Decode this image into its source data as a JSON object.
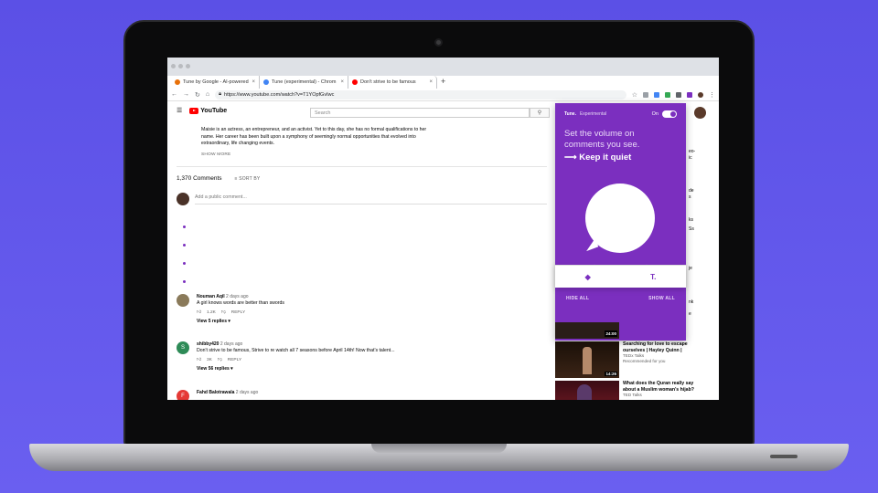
{
  "browser": {
    "tabs": [
      {
        "label": "Tune by Google - AI-powered",
        "color": "#e8710a"
      },
      {
        "label": "Tune (experimental) - Chrom",
        "color": "#4285f4"
      },
      {
        "label": "Don't strive to be famous",
        "color": "#ff0000"
      }
    ],
    "new_tab_icon": "+",
    "url": "https://www.youtube.com/watch?v=T1YOpfGvIwc"
  },
  "youtube": {
    "logo": "YouTube",
    "search_placeholder": "Search",
    "description": "Maisie is an actress, an entrepreneur, and an activist. Yet to this day, she has no formal qualifications to her name. Her career has been built upon a symphony of seemingly normal opportunities that evolved into extraordinary, life changing events.",
    "show_more": "SHOW MORE",
    "comments_count": "1,370 Comments",
    "sort_by": "SORT BY",
    "add_comment_placeholder": "Add a public comment...",
    "comments": [
      {
        "author": "Nouman Aqil",
        "time": "2 days ago",
        "text": "A girl knows words are better than swords",
        "likes": "1.2K",
        "reply": "REPLY",
        "replies": "View 5 replies",
        "avatar_color": "#8a7a5a"
      },
      {
        "author": "shibby420",
        "time": "2 days ago",
        "text": "Don't strive to be famous, Strive to re watch all 7 seasons before April 14th! Now that's talent...",
        "likes": "3K",
        "reply": "REPLY",
        "replies": "View 56 replies",
        "avatar_color": "#2e8b57",
        "initial": "S"
      },
      {
        "author": "Fahd Balotrawala",
        "time": "2 days ago",
        "text": "",
        "avatar_color": "#e53935",
        "initial": "F"
      }
    ],
    "sidebar_fragments": [
      "eo-",
      "ic",
      "de",
      "s",
      "ks",
      "Ss",
      "je",
      "nk",
      "e",
      "er",
      "s",
      "lei"
    ],
    "videos": [
      {
        "title": "Searching for love to escape ourselves | Hayley Quinn |",
        "channel": "TEDx Talks",
        "meta": "Recommended for you",
        "duration": "14:26"
      },
      {
        "title": "What does the Quran really say about a Muslim woman's hijab?",
        "channel": "TED Talks",
        "meta": ""
      }
    ],
    "prev_duration": "24:00"
  },
  "tune": {
    "brand": "Tune.",
    "experimental": "Experimental",
    "on_label": "On",
    "headline": "Set the volume on comments you see.",
    "subline": "⟶ Keep it quiet",
    "hide_all": "HIDE ALL",
    "show_all": "SHOW ALL",
    "footer_right": "T.",
    "accent": "#7b2fbf"
  }
}
